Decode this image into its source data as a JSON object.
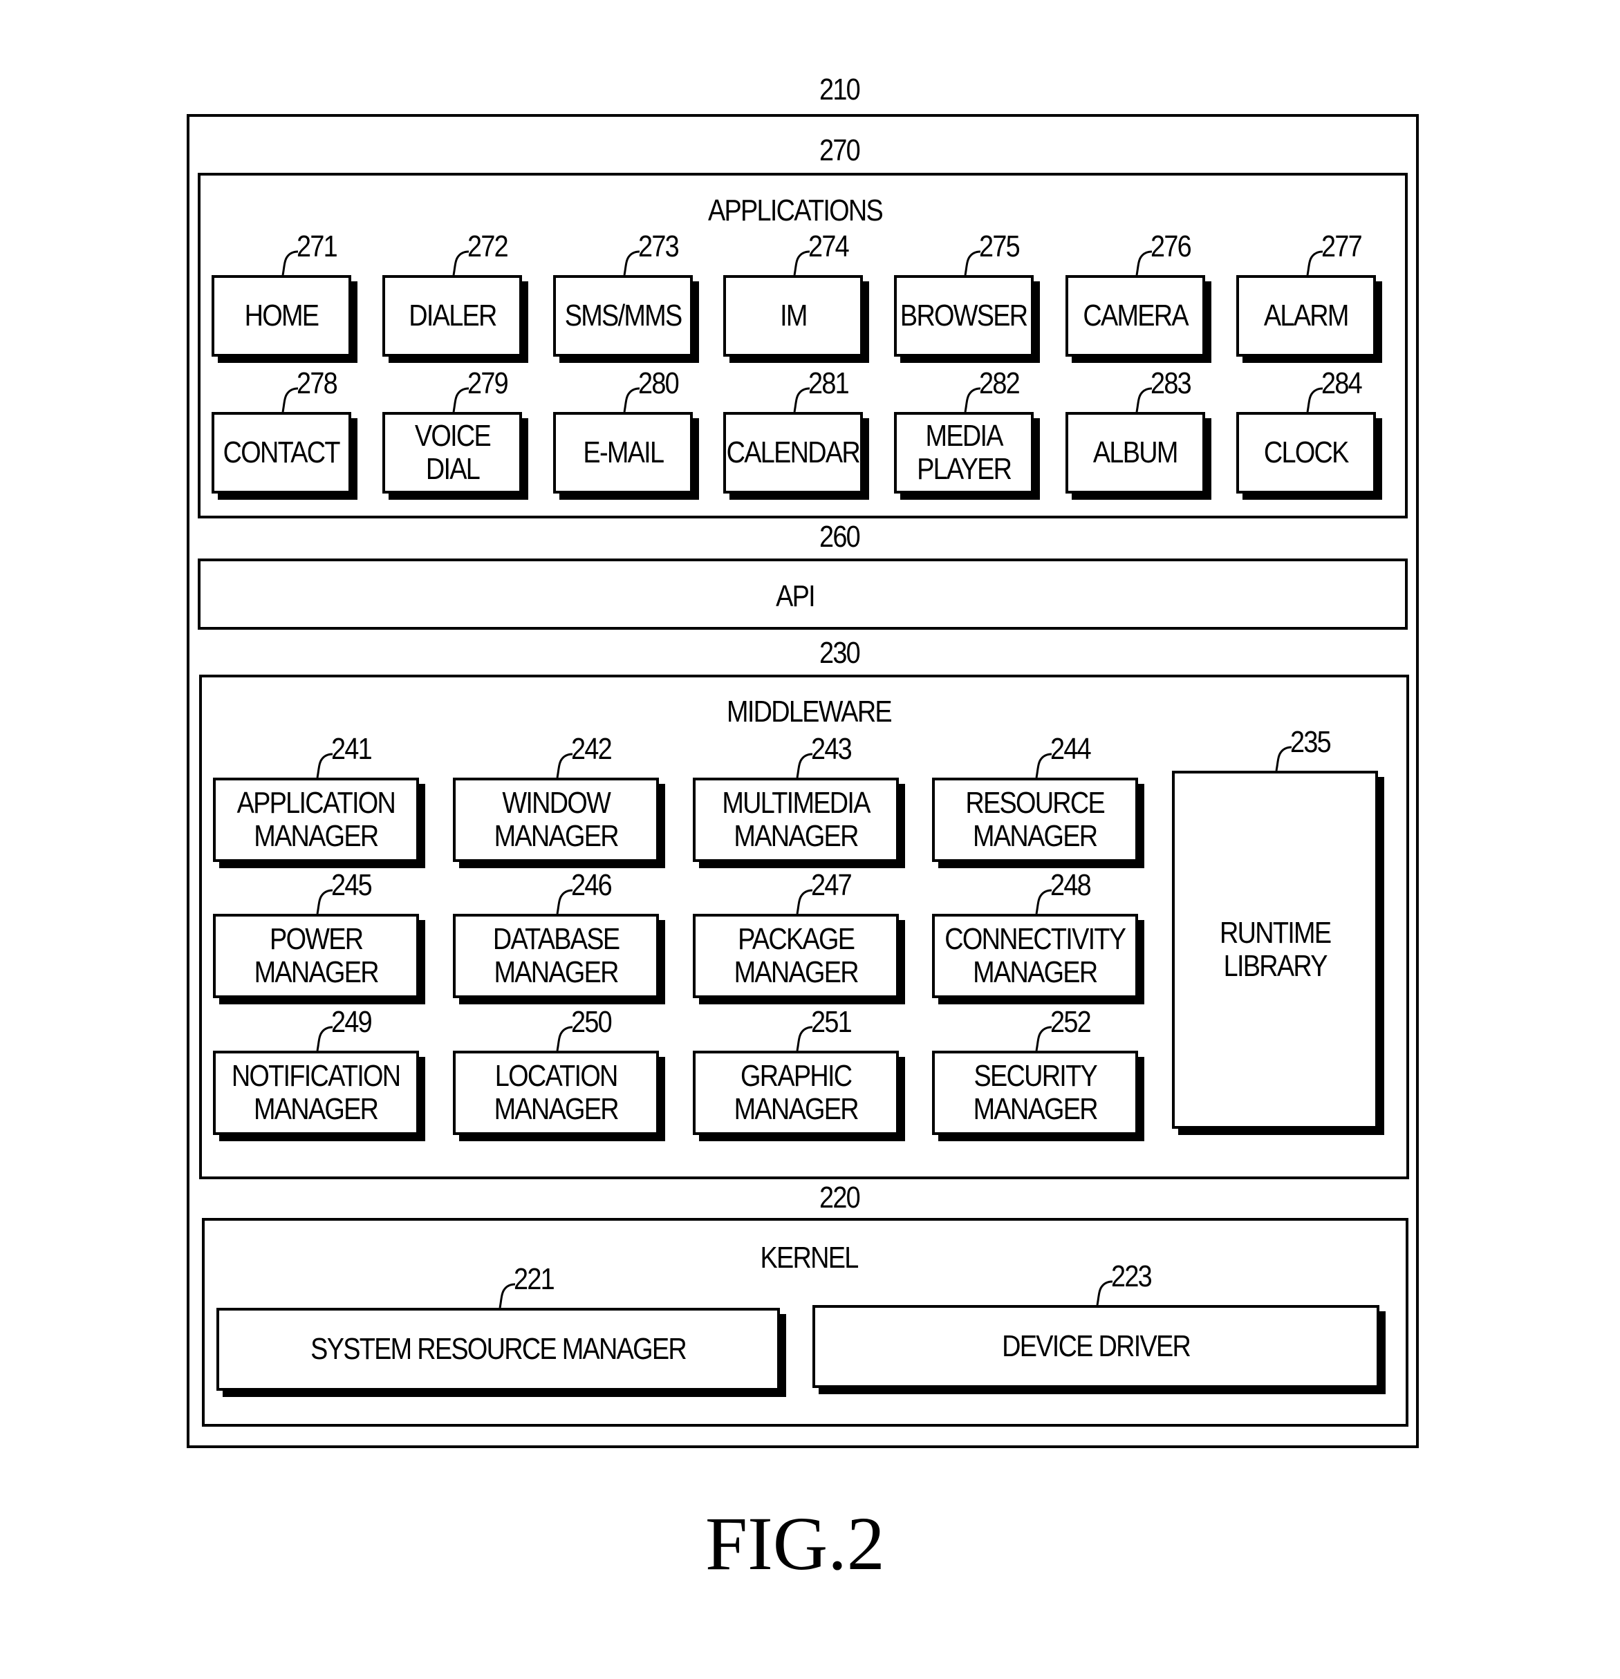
{
  "figure_label": "FIG.2",
  "system": {
    "ref": "210"
  },
  "applications": {
    "ref": "270",
    "title": "APPLICATIONS",
    "items": [
      {
        "ref": "271",
        "label": "HOME"
      },
      {
        "ref": "272",
        "label": "DIALER"
      },
      {
        "ref": "273",
        "label": "SMS/MMS"
      },
      {
        "ref": "274",
        "label": "IM"
      },
      {
        "ref": "275",
        "label": "BROWSER"
      },
      {
        "ref": "276",
        "label": "CAMERA"
      },
      {
        "ref": "277",
        "label": "ALARM"
      },
      {
        "ref": "278",
        "label": "CONTACT"
      },
      {
        "ref": "279",
        "label": "VOICE\nDIAL"
      },
      {
        "ref": "280",
        "label": "E-MAIL"
      },
      {
        "ref": "281",
        "label": "CALENDAR"
      },
      {
        "ref": "282",
        "label": "MEDIA\nPLAYER"
      },
      {
        "ref": "283",
        "label": "ALBUM"
      },
      {
        "ref": "284",
        "label": "CLOCK"
      }
    ]
  },
  "api": {
    "ref": "260",
    "title": "API"
  },
  "middleware": {
    "ref": "230",
    "title": "MIDDLEWARE",
    "items": [
      {
        "ref": "241",
        "label": "APPLICATION\nMANAGER"
      },
      {
        "ref": "242",
        "label": "WINDOW\nMANAGER"
      },
      {
        "ref": "243",
        "label": "MULTIMEDIA\nMANAGER"
      },
      {
        "ref": "244",
        "label": "RESOURCE\nMANAGER"
      },
      {
        "ref": "245",
        "label": "POWER\nMANAGER"
      },
      {
        "ref": "246",
        "label": "DATABASE\nMANAGER"
      },
      {
        "ref": "247",
        "label": "PACKAGE\nMANAGER"
      },
      {
        "ref": "248",
        "label": "CONNECTIVITY\nMANAGER"
      },
      {
        "ref": "249",
        "label": "NOTIFICATION\nMANAGER"
      },
      {
        "ref": "250",
        "label": "LOCATION\nMANAGER"
      },
      {
        "ref": "251",
        "label": "GRAPHIC\nMANAGER"
      },
      {
        "ref": "252",
        "label": "SECURITY\nMANAGER"
      }
    ],
    "runtime": {
      "ref": "235",
      "label": "RUNTIME\nLIBRARY"
    }
  },
  "kernel": {
    "ref": "220",
    "title": "KERNEL",
    "items": [
      {
        "ref": "221",
        "label": "SYSTEM RESOURCE MANAGER"
      },
      {
        "ref": "223",
        "label": "DEVICE DRIVER"
      }
    ]
  }
}
